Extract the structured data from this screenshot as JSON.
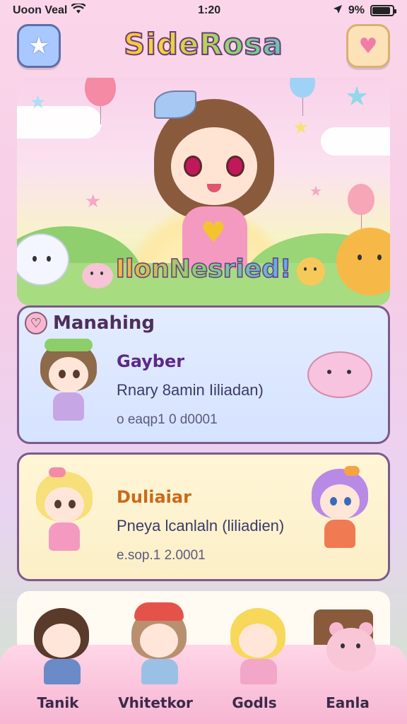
{
  "status_bar": {
    "carrier": "Uoon Veal",
    "time": "1:20",
    "battery": "9%",
    "battery_level": 0.9
  },
  "header": {
    "title": "SideRosa",
    "left_icon": "star-icon",
    "right_icon": "heart-message-icon"
  },
  "hero": {
    "caption": "IlonNesried!"
  },
  "sections": {
    "heading": "Manahing",
    "heading_icon": "heart-badge-icon"
  },
  "cards": [
    {
      "name": "Gayber",
      "name_color": "#5b2a8a",
      "description": "Rnary 8amin Iiliadan)",
      "meta": "o eaqp1 0 d0001"
    },
    {
      "name": "Duliaiar",
      "name_color": "#c96a1a",
      "description": "Pneya lcanlaln (liliadien)",
      "meta": "e.sop.1 2.0001"
    }
  ],
  "tabs": [
    {
      "label": "Tanik",
      "icon": "tanik-avatar"
    },
    {
      "label": "Vhitetkor",
      "icon": "vhitetkor-avatar"
    },
    {
      "label": "Godls",
      "icon": "godls-avatar"
    },
    {
      "label": "Eanla",
      "icon": "eanla-bear-icon"
    }
  ],
  "colors": {
    "accent_pink": "#f7b5d2",
    "card_blue": "#d6e3ff",
    "card_yellow": "#fcefc8",
    "border_purple": "#7b5a8a"
  }
}
